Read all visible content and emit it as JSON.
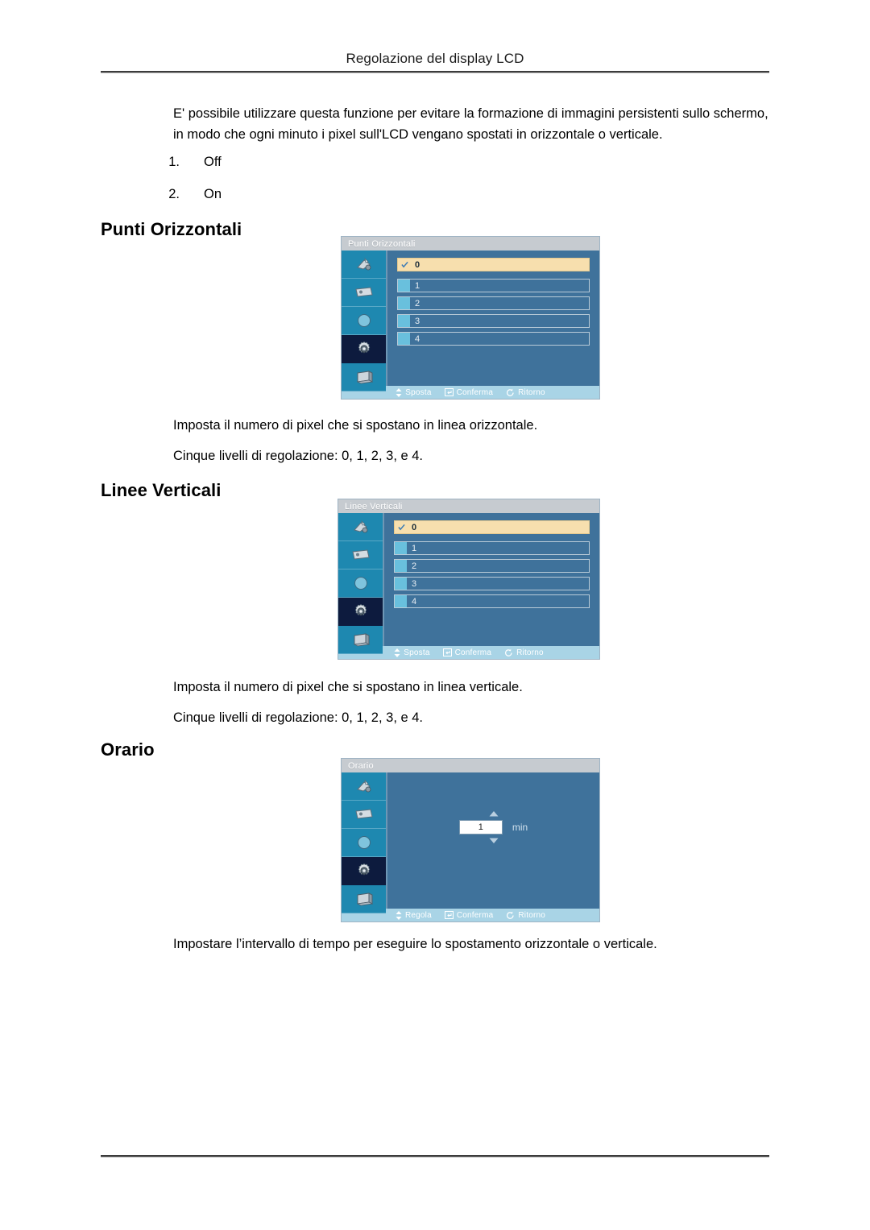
{
  "header": {
    "running_title": "Regolazione del display LCD"
  },
  "intro": {
    "text": "E' possibile utilizzare questa funzione per evitare la formazione di immagini persistenti sullo schermo, in modo che ogni minuto i pixel sull'LCD vengano spostati in orizzontale o verticale."
  },
  "options_list": [
    {
      "number": "1.",
      "label": "Off"
    },
    {
      "number": "2.",
      "label": "On"
    }
  ],
  "sections": [
    {
      "heading": "Punti Orizzontali",
      "osd": {
        "title": "Punti Orizzontali",
        "sidebar_icons": [
          "input-source-icon",
          "picture-icon",
          "contrast-circle-icon",
          "setup-gear-icon",
          "display-screen-icon"
        ],
        "selected_sidebar_index": 3,
        "options": [
          "0",
          "1",
          "2",
          "3",
          "4"
        ],
        "selected_option": "0",
        "footer": [
          {
            "icon": "up-down-arrow-icon",
            "label": "Sposta"
          },
          {
            "icon": "enter-key-icon",
            "label": "Conferma"
          },
          {
            "icon": "return-icon",
            "label": "Ritorno"
          }
        ]
      },
      "paragraphs": [
        "Imposta il numero di pixel che si spostano in linea orizzontale.",
        "Cinque livelli di regolazione: 0, 1, 2, 3, e 4."
      ]
    },
    {
      "heading": "Linee Verticali",
      "osd": {
        "title": "Linee Verticali",
        "sidebar_icons": [
          "input-source-icon",
          "picture-icon",
          "contrast-circle-icon",
          "setup-gear-icon",
          "display-screen-icon"
        ],
        "selected_sidebar_index": 3,
        "options": [
          "0",
          "1",
          "2",
          "3",
          "4"
        ],
        "selected_option": "0",
        "footer": [
          {
            "icon": "up-down-arrow-icon",
            "label": "Sposta"
          },
          {
            "icon": "enter-key-icon",
            "label": "Conferma"
          },
          {
            "icon": "return-icon",
            "label": "Ritorno"
          }
        ]
      },
      "paragraphs": [
        "Imposta il numero di pixel che si spostano in linea verticale.",
        "Cinque livelli di regolazione: 0, 1, 2, 3, e 4."
      ]
    },
    {
      "heading": "Orario",
      "osd": {
        "title": "Orario",
        "sidebar_icons": [
          "input-source-icon",
          "picture-icon",
          "contrast-circle-icon",
          "setup-gear-icon",
          "display-screen-icon"
        ],
        "selected_sidebar_index": 3,
        "spinner": {
          "value": "1",
          "unit": "min"
        },
        "footer": [
          {
            "icon": "up-down-arrow-icon",
            "label": "Regola"
          },
          {
            "icon": "enter-key-icon",
            "label": "Conferma"
          },
          {
            "icon": "return-icon",
            "label": "Ritorno"
          }
        ]
      },
      "paragraphs": [
        "Impostare l’intervallo di tempo per eseguire lo spostamento orizzontale o verticale."
      ]
    }
  ],
  "colors": {
    "osd_background": "#3f729b",
    "osd_titlebar": "#c6cbd0",
    "osd_sidebar": "#1e88b0",
    "osd_sidebar_selected": "#0d1b3e",
    "osd_footer": "#a9d4e6",
    "option_selected": "#f7dfae",
    "option_chip": "#69c0dd"
  }
}
